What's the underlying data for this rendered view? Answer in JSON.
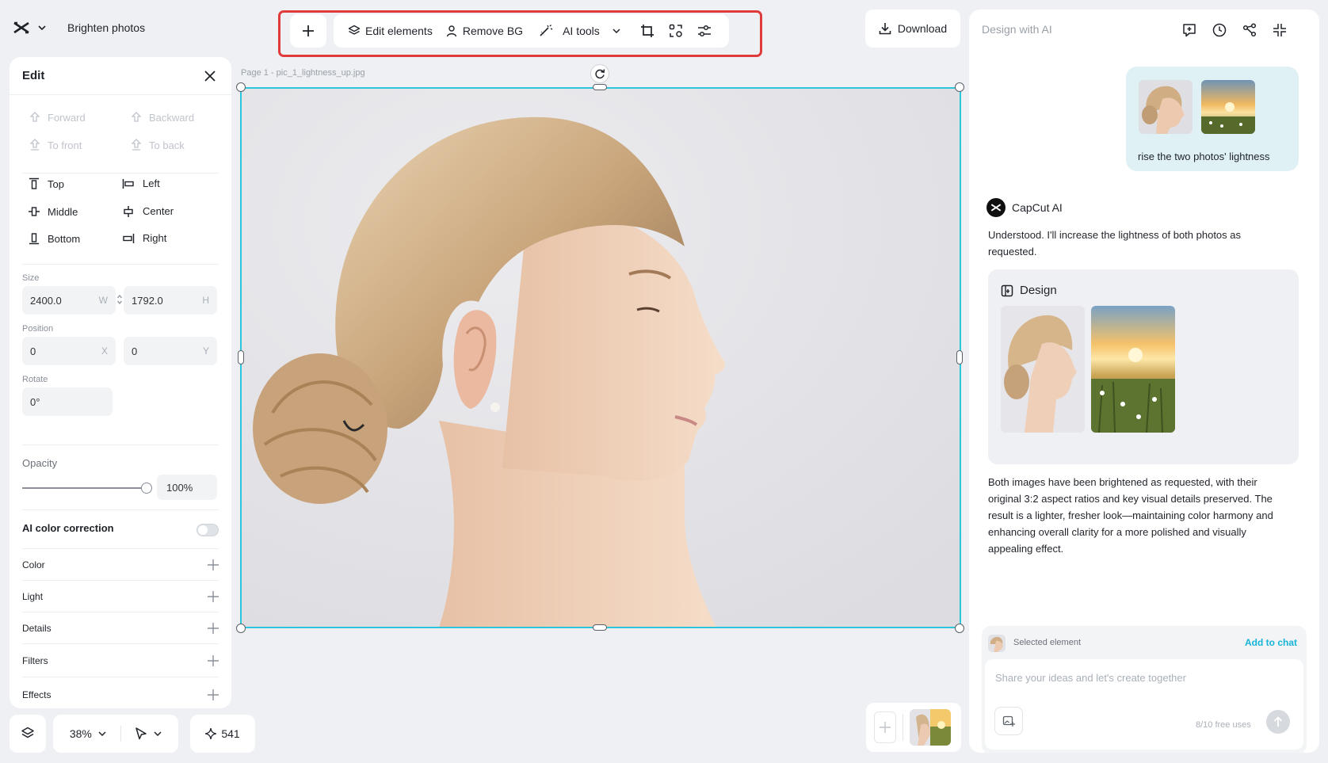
{
  "app": {
    "project_title": "Brighten photos"
  },
  "toolbar": {
    "edit_elements": "Edit elements",
    "remove_bg": "Remove BG",
    "ai_tools": "AI tools",
    "download": "Download"
  },
  "edit_panel": {
    "title": "Edit",
    "arrange": [
      "Forward",
      "Backward",
      "To front",
      "To back"
    ],
    "align": [
      "Top",
      "Left",
      "Middle",
      "Center",
      "Bottom",
      "Right"
    ],
    "size_label": "Size",
    "width": "2400.0",
    "width_unit": "W",
    "height": "1792.0",
    "height_unit": "H",
    "position_label": "Position",
    "x": "0",
    "x_unit": "X",
    "y": "0",
    "y_unit": "Y",
    "rotate_label": "Rotate",
    "rotate": "0°",
    "opacity_label": "Opacity",
    "opacity": "100%",
    "opacity_fraction": 1.0,
    "ai_color_correction": "AI color correction",
    "ai_color_correction_on": false,
    "sections": [
      "Color",
      "Light",
      "Details",
      "Filters",
      "Effects"
    ]
  },
  "bottom_bar": {
    "zoom": "38%",
    "credits": "541"
  },
  "canvas": {
    "page_label": "Page 1 -   pic_1_lightness_up.jpg"
  },
  "ai_panel": {
    "title": "Design with AI",
    "user_message": "rise the two photos' lightness",
    "assistant_name": "CapCut AI",
    "reply_1": "Understood. I'll increase the lightness of both photos as requested.",
    "design_title": "Design",
    "reply_2": "Both images have been brightened as requested, with their original 3:2 aspect ratios and key visual details preserved. The result is a lighter, fresher look—maintaining color harmony and enhancing overall clarity for a more polished and visually appealing effect.",
    "selected_element_label": "Selected element",
    "add_to_chat": "Add to chat",
    "input_placeholder": "Share your ideas and let's create together",
    "free_uses": "8/10 free uses"
  },
  "colors": {
    "accent": "#2cc5d9",
    "highlight_outline": "#e03b3b",
    "link": "#16b5d8"
  }
}
